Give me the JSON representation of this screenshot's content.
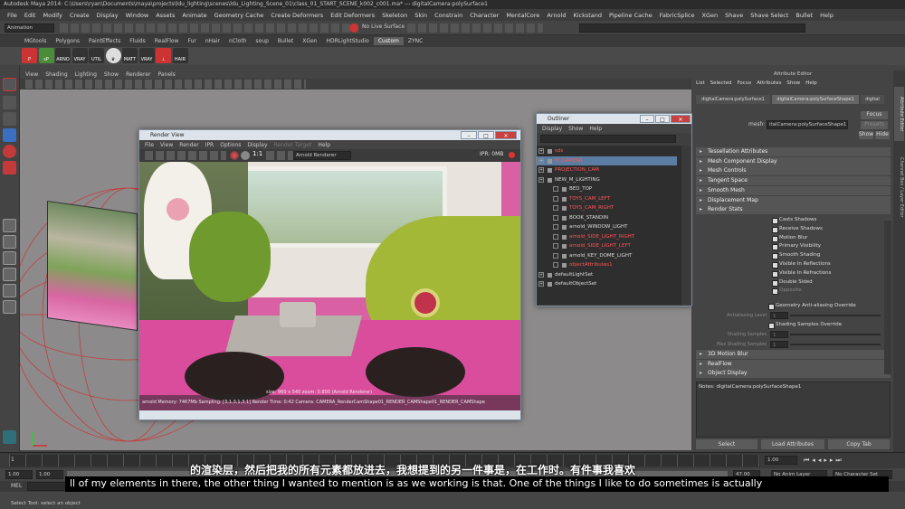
{
  "window": {
    "title": "Autodesk Maya 2014: C:\\Users\\ryan\\Documents\\maya\\projects\\ldu_lighting\\scenes\\ldu_Lighting_Scene_01\\class_01_START_SCENE_k002_c001.ma*  ---  digitalCamera:polySurface1"
  },
  "menubar": [
    "File",
    "Edit",
    "Modify",
    "Create",
    "Display",
    "Window",
    "Assets",
    "Animate",
    "Geometry Cache",
    "Create Deformers",
    "Edit Deformers",
    "Skeleton",
    "Skin",
    "Constrain",
    "Character",
    "MentalCore",
    "Arnold",
    "Kickstand",
    "Pipeline Cache",
    "FabricSplice",
    "XGen",
    "Shave",
    "Shave Select",
    "Bullet",
    "Help"
  ],
  "statusline": {
    "mode": "Animation",
    "live_surface": "No Live Surface"
  },
  "shelf_tabs": {
    "items": [
      "MGtools",
      "Polygons",
      "PaintEffects",
      "Fluids",
      "RealFlow",
      "Fur",
      "nHair",
      "nCloth",
      "soup",
      "Bullet",
      "XGen",
      "HDRLightStudio",
      "Custom",
      "ZYNC"
    ],
    "active": "Custom"
  },
  "shelf_buttons": [
    "P",
    "sP",
    "ARNO",
    "VRAY",
    "UTIL",
    "♛",
    "MATT",
    "VRAY",
    "⊥",
    "HAIR"
  ],
  "viewport": {
    "menu": [
      "View",
      "Shading",
      "Lighting",
      "Show",
      "Renderer",
      "Panels"
    ]
  },
  "render_view": {
    "title": "Render View",
    "menu": [
      "File",
      "View",
      "Render",
      "IPR",
      "Options",
      "Display",
      "Render Target",
      "Help"
    ],
    "ratio": "1:1",
    "renderer": "Arnold Renderer",
    "ipr": "IPR: 0MB",
    "overlay_line1": "size: 960 x 540  zoom: 0.800     (Arnold Renderer)",
    "overlay_line2": "arnold  Memory: 7467Mb   Sampling: [3,1,3,1,3,1]   Render Time: 0:42   Camera: CAMERA_RenderCamShape01_RENDER_CAMShape01_RENDER_CAMShape"
  },
  "outliner": {
    "title": "Outliner",
    "menu": [
      "Display",
      "Show",
      "Help"
    ],
    "items": [
      {
        "label": "sds",
        "color": "#ff5555",
        "indent": 0
      },
      {
        "label": "M_CAMERA",
        "color": "#ff5555",
        "indent": 0,
        "selected": true
      },
      {
        "label": "PROJECTION_CAM",
        "color": "#ff5555",
        "indent": 0
      },
      {
        "label": "NEW_M_LIGHTING",
        "color": "#dddddd",
        "indent": 0
      },
      {
        "label": "BED_TOP",
        "color": "#dddddd",
        "indent": 1
      },
      {
        "label": "TOYS_CAM_LEFT",
        "color": "#ff5555",
        "indent": 1
      },
      {
        "label": "TOYS_CAM_RIGHT",
        "color": "#ff5555",
        "indent": 1
      },
      {
        "label": "BOOK_STANDIN",
        "color": "#dddddd",
        "indent": 1
      },
      {
        "label": "arnold_WINDOW_LIGHT",
        "color": "#dddddd",
        "indent": 1
      },
      {
        "label": "arnold_SIDE_LIGHT_RIGHT",
        "color": "#ff5555",
        "indent": 1
      },
      {
        "label": "arnold_SIDE_LIGHT_LEFT",
        "color": "#ff5555",
        "indent": 1
      },
      {
        "label": "arnold_KEY_DOME_LIGHT",
        "color": "#dddddd",
        "indent": 1
      },
      {
        "label": "objectAttributes1",
        "color": "#ff5555",
        "indent": 1
      },
      {
        "label": "defaultLightSet",
        "color": "#dddddd",
        "indent": 0
      },
      {
        "label": "defaultObjectSet",
        "color": "#dddddd",
        "indent": 0
      }
    ]
  },
  "attribute_editor": {
    "title": "Attribute Editor",
    "menu": [
      "List",
      "Selected",
      "Focus",
      "Attributes",
      "Show",
      "Help"
    ],
    "tabs": [
      "digitalCamera:polySurface1",
      "digitalCamera:polySurfaceShape1",
      "digital"
    ],
    "mesh_label": "mesh:",
    "mesh_value": "italCamera:polySurfaceShape1",
    "buttons": {
      "focus": "Focus",
      "presets": "Presets",
      "show": "Show",
      "hide": "Hide"
    },
    "sections": [
      "Tessellation Attributes",
      "Mesh Component Display",
      "Mesh Controls",
      "Tangent Space",
      "Smooth Mesh",
      "Displacement Map",
      "Render Stats"
    ],
    "render_stats": [
      "Casts Shadows",
      "Receive Shadows",
      "Motion Blur",
      "Primary Visibility",
      "Smooth Shading",
      "Visible In Reflections",
      "Visible In Refractions",
      "Double Sided",
      "Opposite"
    ],
    "geom_aa": "Geometry Anti-aliasing Override",
    "aa_level": "Antialiasing Level",
    "aa_level_value": "1",
    "shading_override": "Shading Samples Override",
    "shading_samples": "Shading Samples",
    "shading_samples_value": "1",
    "max_shading_samples": "Max Shading Samples",
    "max_shading_samples_value": "1",
    "sections2": [
      "3D Motion Blur",
      "RealFlow",
      "Object Display"
    ],
    "notes": "Notes: digitalCamera:polySurfaceShape1",
    "footer": [
      "Select",
      "Load Attributes",
      "Copy Tab"
    ],
    "side_tabs": [
      "Attribute Editor",
      "Channel Box / Layer Editor"
    ]
  },
  "timeline": {
    "start": "1",
    "current_left": "1.00",
    "current_right": "1.00",
    "mark": "1.00"
  },
  "range": {
    "start": "1.00",
    "start2": "1.00",
    "end": "47.00",
    "anim_layer": "No Anim Layer",
    "char_set": "No Character Set"
  },
  "command_line": {
    "label": "MEL"
  },
  "help_line": "Select Tool: select an object",
  "subtitles": {
    "zh": "的渲染层，然后把我的所有元素都放进去，我想提到的另一件事是，在工作时。有件事我喜欢",
    "en": "ll of my elements in there, the other thing I wanted to mention is as we working is that. One of the things I like to do sometimes is actually"
  }
}
